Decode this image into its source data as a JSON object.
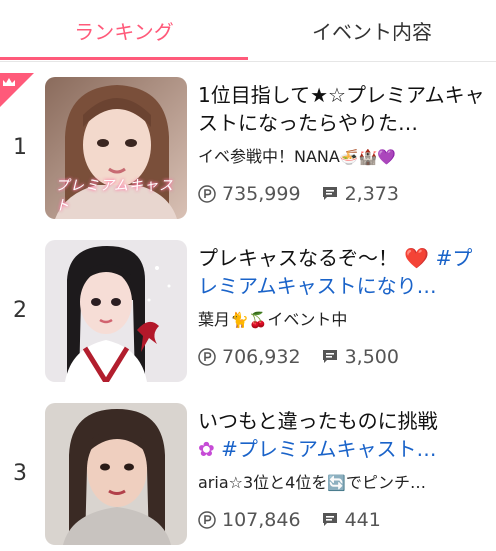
{
  "tabs": {
    "ranking": "ランキング",
    "event": "イベント内容"
  },
  "accent": "#ff5a7a",
  "link_color": "#1a63c9",
  "rows": [
    {
      "rank": "1",
      "title": "1位目指して★☆プレミアムキャストになったらやりた…",
      "status_text": "イベ参戦中！NANA",
      "status_icons": "🍜🏰💜",
      "points": "735,999",
      "comments": "2,373",
      "thumb_caption": "プレミアムキャスト"
    },
    {
      "rank": "2",
      "title_text": "プレキャスなるぞ〜！",
      "title_heart": "❤️",
      "title_hashtag": "#プレミアムキャストになり…",
      "status_prefix": "葉月",
      "status_icons": "🐈🍒",
      "status_suffix": "イベント中",
      "points": "706,932",
      "comments": "3,500"
    },
    {
      "rank": "3",
      "title_text": "いつもと違ったものに挑戦",
      "title_flower": "✿",
      "title_hashtag": "#プレミアムキャスト…",
      "status_prefix": "aria☆3位と4位を",
      "status_icon": "🔄",
      "status_suffix": "でピンチ…",
      "points": "107,846",
      "comments": "441"
    }
  ]
}
